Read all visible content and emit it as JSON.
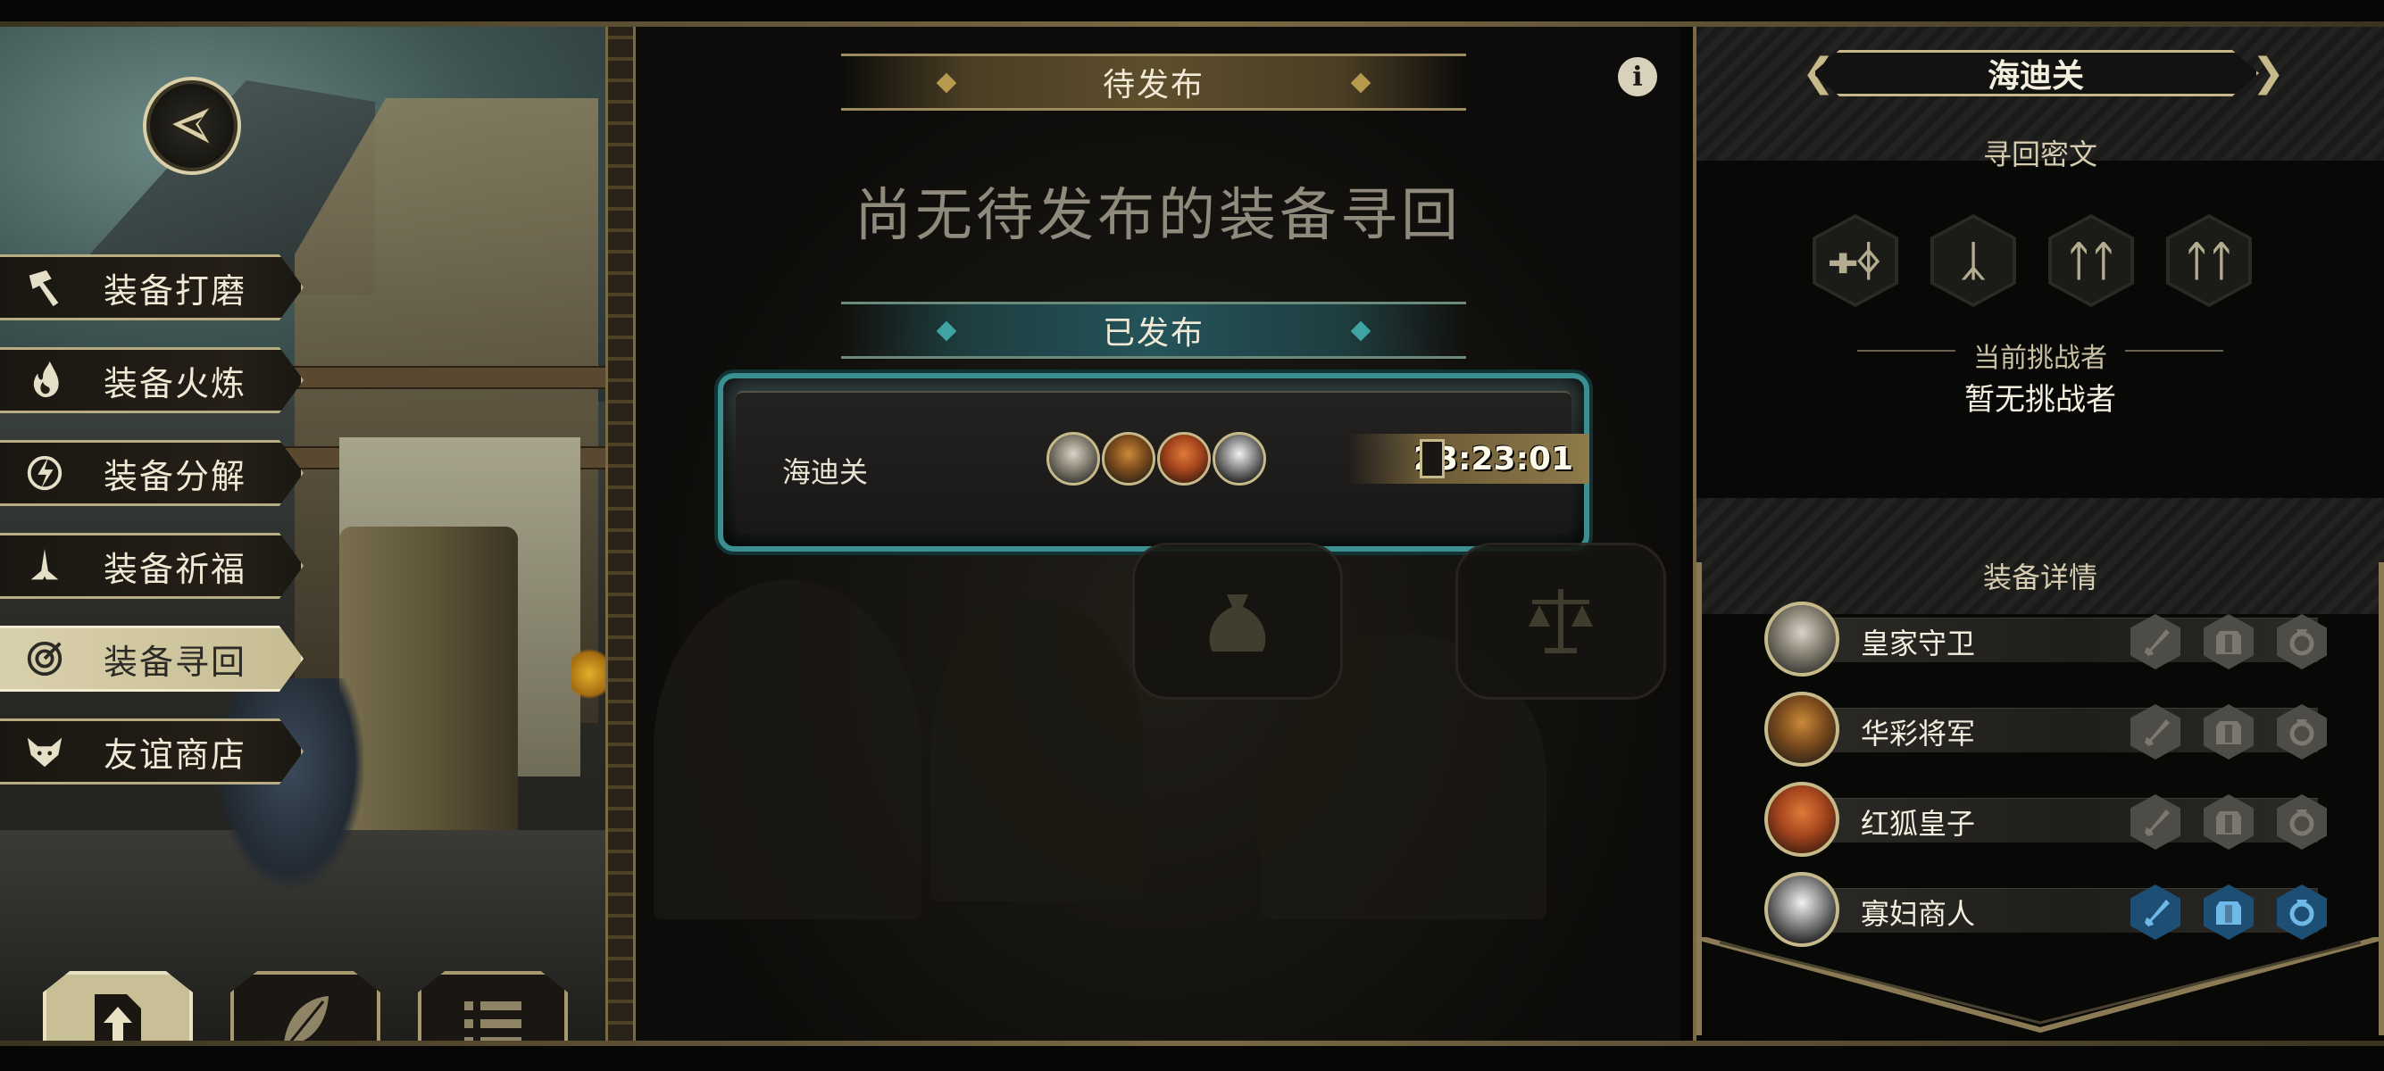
{
  "left_menu": {
    "items": [
      {
        "id": "polish",
        "label": "装备打磨",
        "icon": "hammer-icon"
      },
      {
        "id": "forge",
        "label": "装备火炼",
        "icon": "flame-icon"
      },
      {
        "id": "dismantle",
        "label": "装备分解",
        "icon": "dismantle-icon"
      },
      {
        "id": "bless",
        "label": "装备祈福",
        "icon": "praying-hands-icon"
      },
      {
        "id": "retrieve",
        "label": "装备寻回",
        "icon": "target-icon",
        "active": true
      },
      {
        "id": "shop",
        "label": "友谊商店",
        "icon": "fox-icon"
      }
    ],
    "bottom_tabs": [
      {
        "id": "publish",
        "icon": "upload-document-icon",
        "active": true
      },
      {
        "id": "feather",
        "icon": "feather-icon"
      },
      {
        "id": "list",
        "icon": "list-icon"
      }
    ]
  },
  "center": {
    "pending_title": "待发布",
    "empty_text": "尚无待发布的装备寻回",
    "published_title": "已发布",
    "quest": {
      "name": "海迪关",
      "timer": "23:23:01",
      "avatars": [
        "royal-guard",
        "general",
        "red-fox-prince",
        "widow-merchant"
      ]
    }
  },
  "right_panel": {
    "title": "海迪关",
    "runes_heading": "寻回密文",
    "runes": [
      "ᚐᛄ",
      "ᛣ",
      "ᛏᛏ",
      "ᛏᛏ"
    ],
    "challenger_heading": "当前挑战者",
    "challenger_value": "暂无挑战者",
    "details_heading": "装备详情",
    "heroes": [
      {
        "name": "皇家守卫",
        "slots": [
          false,
          false,
          false
        ]
      },
      {
        "name": "华彩将军",
        "slots": [
          false,
          false,
          false
        ]
      },
      {
        "name": "红狐皇子",
        "slots": [
          false,
          false,
          false
        ]
      },
      {
        "name": "寡妇商人",
        "slots": [
          true,
          true,
          true
        ]
      }
    ]
  },
  "colors": {
    "gold_border": "#c6b98a",
    "teal_accent": "#3b8f91",
    "active_menu": "#d9d0ad",
    "equipped_slot": "#1c4f73"
  }
}
